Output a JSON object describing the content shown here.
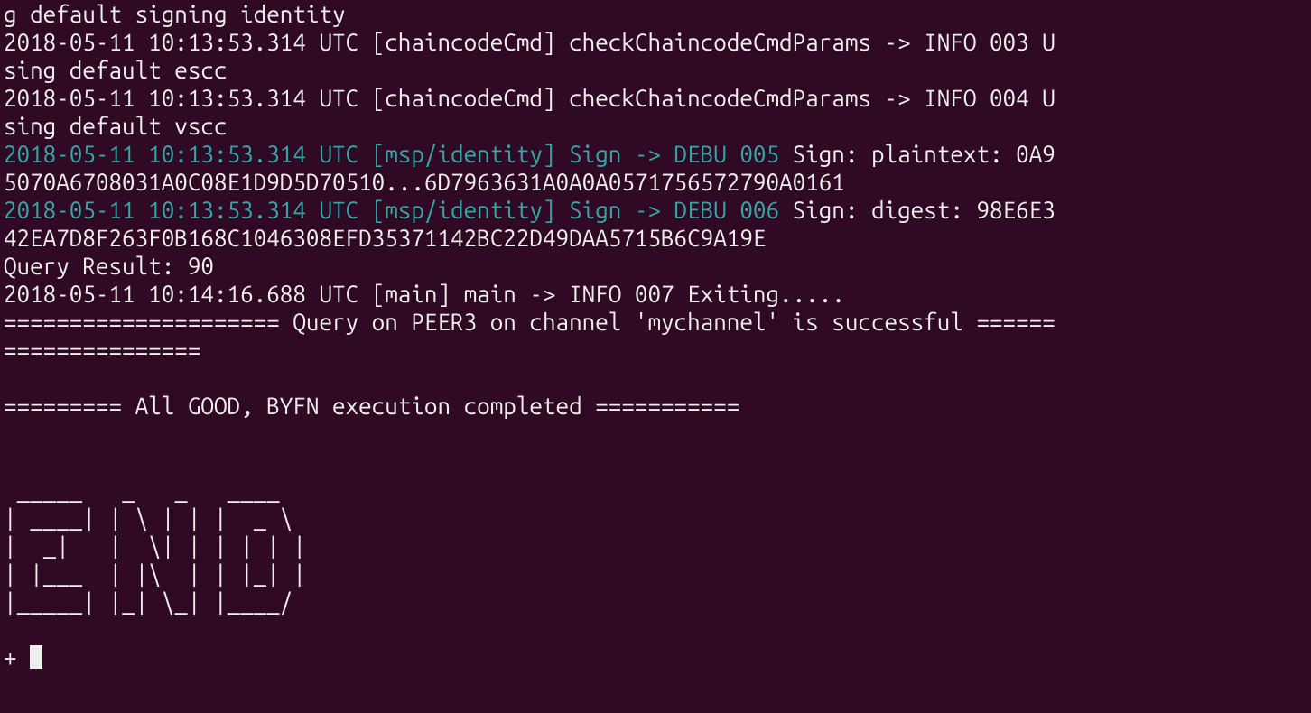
{
  "lines": [
    {
      "segments": [
        {
          "cls": "",
          "key": "l0s0"
        }
      ]
    },
    {
      "segments": [
        {
          "cls": "",
          "key": "l1s0"
        }
      ]
    },
    {
      "segments": [
        {
          "cls": "",
          "key": "l2s0"
        }
      ]
    },
    {
      "segments": [
        {
          "cls": "",
          "key": "l3s0"
        }
      ]
    },
    {
      "segments": [
        {
          "cls": "",
          "key": "l4s0"
        }
      ]
    },
    {
      "segments": [
        {
          "cls": "teal",
          "key": "l5s0"
        },
        {
          "cls": "",
          "key": "l5s1"
        }
      ]
    },
    {
      "segments": [
        {
          "cls": "",
          "key": "l6s0"
        }
      ]
    },
    {
      "segments": [
        {
          "cls": "teal",
          "key": "l7s0"
        },
        {
          "cls": "",
          "key": "l7s1"
        }
      ]
    },
    {
      "segments": [
        {
          "cls": "",
          "key": "l8s0"
        }
      ]
    },
    {
      "segments": [
        {
          "cls": "",
          "key": "l9s0"
        }
      ]
    },
    {
      "segments": [
        {
          "cls": "",
          "key": "l10s0"
        }
      ]
    },
    {
      "segments": [
        {
          "cls": "",
          "key": "l11s0"
        }
      ]
    },
    {
      "segments": [
        {
          "cls": "",
          "key": "l12s0"
        }
      ]
    },
    {
      "segments": [
        {
          "cls": "",
          "key": "blank"
        }
      ]
    },
    {
      "segments": [
        {
          "cls": "",
          "key": "l14s0"
        }
      ]
    },
    {
      "segments": [
        {
          "cls": "",
          "key": "blank"
        }
      ]
    },
    {
      "segments": [
        {
          "cls": "",
          "key": "blank"
        }
      ]
    },
    {
      "segments": [
        {
          "cls": "",
          "key": "l17s0"
        }
      ]
    },
    {
      "segments": [
        {
          "cls": "",
          "key": "l18s0"
        }
      ]
    },
    {
      "segments": [
        {
          "cls": "",
          "key": "l19s0"
        }
      ]
    },
    {
      "segments": [
        {
          "cls": "",
          "key": "l20s0"
        }
      ]
    },
    {
      "segments": [
        {
          "cls": "",
          "key": "l21s0"
        }
      ]
    },
    {
      "segments": [
        {
          "cls": "",
          "key": "blank"
        }
      ]
    }
  ],
  "text": {
    "blank": " ",
    "l0s0": "g default signing identity",
    "l1s0": "2018-05-11 10:13:53.314 UTC [chaincodeCmd] checkChaincodeCmdParams -> INFO 003 U",
    "l2s0": "sing default escc",
    "l3s0": "2018-05-11 10:13:53.314 UTC [chaincodeCmd] checkChaincodeCmdParams -> INFO 004 U",
    "l4s0": "sing default vscc",
    "l5s0": "2018-05-11 10:13:53.314 UTC [msp/identity] Sign -> DEBU 005",
    "l5s1": " Sign: plaintext: 0A9",
    "l6s0": "5070A6708031A0C08E1D9D5D70510...6D7963631A0A0A0571756572790A0161 ",
    "l7s0": "2018-05-11 10:13:53.314 UTC [msp/identity] Sign -> DEBU 006",
    "l7s1": " Sign: digest: 98E6E3",
    "l8s0": "42EA7D8F263F0B168C1046308EFD35371142BC22D49DAA5715B6C9A19E ",
    "l9s0": "Query Result: 90",
    "l10s0": "2018-05-11 10:14:16.688 UTC [main] main -> INFO 007 Exiting.....",
    "l11s0": "===================== Query on PEER3 on channel 'mychannel' is successful ======",
    "l12s0": "=============== ",
    "l14s0": "========= All GOOD, BYFN execution completed =========== ",
    "l17s0": " _____   _   _   ____   ",
    "l18s0": "| ____| | \\ | | |  _ \\  ",
    "l19s0": "|  _|   |  \\| | | | | | ",
    "l20s0": "| |___  | |\\  | | |_| | ",
    "l21s0": "|_____| |_| \\_| |____/  ",
    "prompt": "+ "
  }
}
